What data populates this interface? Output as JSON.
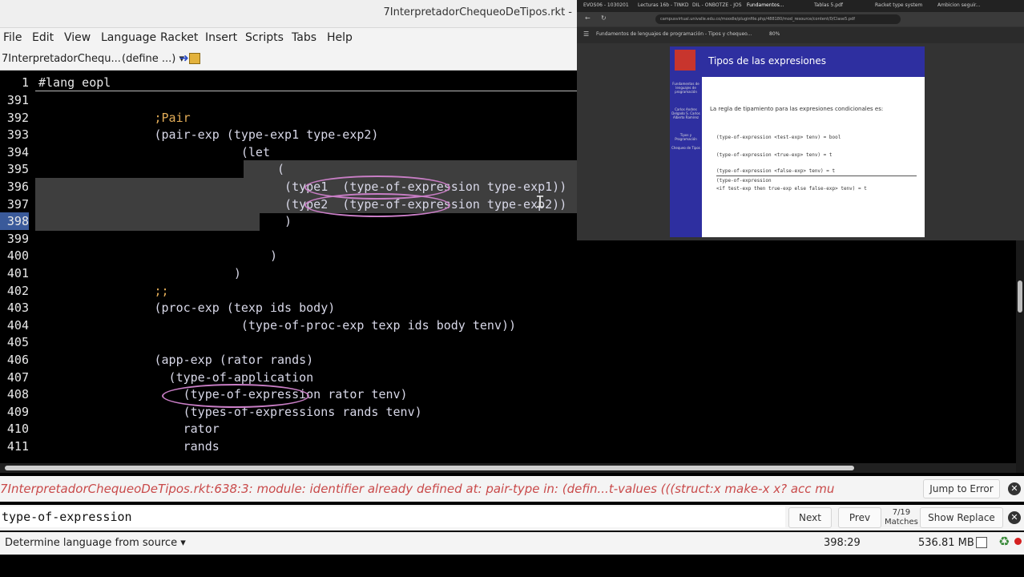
{
  "window": {
    "title": "7InterpretadorChequeoDeTipos.rkt -"
  },
  "menu": [
    "File",
    "Edit",
    "View",
    "Language",
    "Racket",
    "Insert",
    "Scripts",
    "Tabs",
    "Help"
  ],
  "toolbar": {
    "filename": "7InterpretadorChequ...",
    "define_menu": "(define ...)"
  },
  "editor": {
    "header_line_number": "1",
    "header_code": "#lang eopl",
    "lines": [
      {
        "n": "391",
        "code": ""
      },
      {
        "n": "392",
        "code": "                ;Pair"
      },
      {
        "n": "393",
        "code": "                (pair-exp (type-exp1 type-exp2)"
      },
      {
        "n": "394",
        "code": "                            (let"
      },
      {
        "n": "395",
        "code": "                                 ("
      },
      {
        "n": "396",
        "code": "                                  (type1  (type-of-expression type-exp1))"
      },
      {
        "n": "397",
        "code": "                                  (type2  (type-of-expression type-exp2))"
      },
      {
        "n": "398",
        "code": "                                  )"
      },
      {
        "n": "399",
        "code": ""
      },
      {
        "n": "400",
        "code": "                                )"
      },
      {
        "n": "401",
        "code": "                           )"
      },
      {
        "n": "402",
        "code": "                ;;"
      },
      {
        "n": "403",
        "code": "                (proc-exp (texp ids body)"
      },
      {
        "n": "404",
        "code": "                            (type-of-proc-exp texp ids body tenv))"
      },
      {
        "n": "405",
        "code": ""
      },
      {
        "n": "406",
        "code": "                (app-exp (rator rands)"
      },
      {
        "n": "407",
        "code": "                  (type-of-application"
      },
      {
        "n": "408",
        "code": "                    (type-of-expression rator tenv)"
      },
      {
        "n": "409",
        "code": "                    (types-of-expressions rands tenv)"
      },
      {
        "n": "410",
        "code": "                    rator"
      },
      {
        "n": "411",
        "code": "                    rands"
      }
    ]
  },
  "error": {
    "message": "7InterpretadorChequeoDeTipos.rkt:638:3: module: identifier already defined at: pair-type in: (defin...t-values (((struct:x make-x x? acc mu",
    "jump_label": "Jump to Error"
  },
  "search": {
    "value": "type-of-expression",
    "next_label": "Next",
    "prev_label": "Prev",
    "matches_count": "7/19",
    "matches_label": "Matches",
    "replace_label": "Show Replace"
  },
  "status": {
    "language": "Determine language from source",
    "position": "398:29",
    "memory": "536.81 MB"
  },
  "browser": {
    "tabs": [
      "EVOS06 - 1030201",
      "Lecturas 16b - TINKD",
      "DIL - ONBOTZE - JOS",
      "Fundamentos...",
      "Tablas 5.pdf",
      "Racket type system",
      "Ambicion seguir..."
    ],
    "url": "campusvirtual.univalle.edu.co/moodle/pluginfile.php/488180/mod_resource/content/0/Clase5.pdf",
    "doc_title": "Fundamentos de lenguajes de programación - Tipos y chequeo...",
    "zoom": "80%",
    "slide": {
      "title": "Tipos de las expresiones",
      "sidebar": [
        "Fundamentos de lenguajes de programación",
        "Carlos Andres Delgado S. Carlos Alberto Ramírez",
        "Tipos y Programación",
        "Chequeo de Tipos"
      ],
      "intro": "La regla de tipamiento para las expresiones condicionales es:",
      "rules": [
        "(type-of-expression <test-exp> tenv) = bool",
        "(type-of-expression <true-exp> tenv) = t",
        "(type-of-expression <false-exp> tenv) = t",
        "(type-of-expression",
        "<if test-exp then true-exp else false-exp> tenv) = t"
      ]
    }
  }
}
